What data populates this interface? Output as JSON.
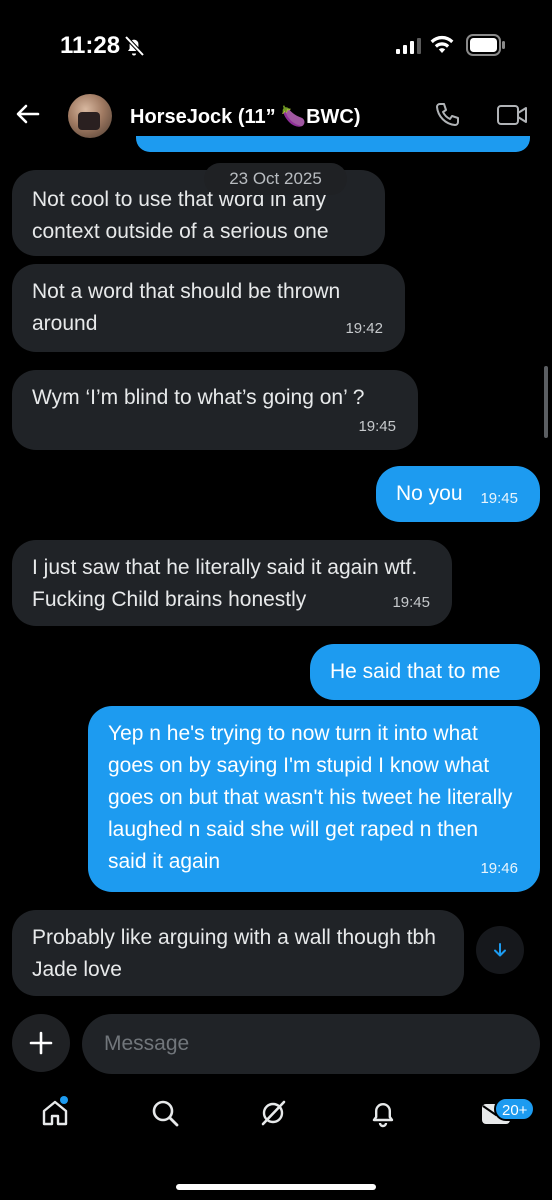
{
  "status_bar": {
    "time": "11:28",
    "icons": [
      "bell-slash-icon",
      "signal-icon",
      "wifi-icon",
      "battery-icon"
    ]
  },
  "header": {
    "contact_name": "HorseJock (11” 🍆BWC)",
    "icons": [
      "back-arrow-icon",
      "phone-icon",
      "video-icon"
    ]
  },
  "conversation": {
    "date_separator": "23 Oct 2025",
    "messages": [
      {
        "direction": "received",
        "text": "Not cool to use that word in any context outside of a serious one",
        "time": ""
      },
      {
        "direction": "received",
        "text": "Not a word that should be thrown around",
        "time": "19:42"
      },
      {
        "direction": "received",
        "text": "Wym ‘I’m blind to what’s going on’ ?",
        "time": "19:45"
      },
      {
        "direction": "sent",
        "text": "No you",
        "time": "19:45"
      },
      {
        "direction": "received",
        "text": "I just saw that he literally said it again wtf. Fucking Child brains honestly",
        "time": "19:45"
      },
      {
        "direction": "sent",
        "text": "He said that to me",
        "time": ""
      },
      {
        "direction": "sent",
        "text": "Yep n he's trying to now turn it into what goes on by saying I'm stupid I know what goes on but that wasn't his tweet he literally laughed n said she will get raped n then said it again",
        "time": "19:46"
      },
      {
        "direction": "received",
        "text": "Probably like arguing with a wall though tbh Jade love",
        "time": ""
      }
    ]
  },
  "composer": {
    "placeholder": "Message"
  },
  "tab_bar": {
    "items": [
      "home-icon",
      "search-icon",
      "grok-icon",
      "notifications-icon",
      "messages-icon"
    ],
    "messages_badge": "20+"
  },
  "colors": {
    "accent": "#1d9bf0",
    "bubble_received": "#202327",
    "background": "#000000"
  }
}
